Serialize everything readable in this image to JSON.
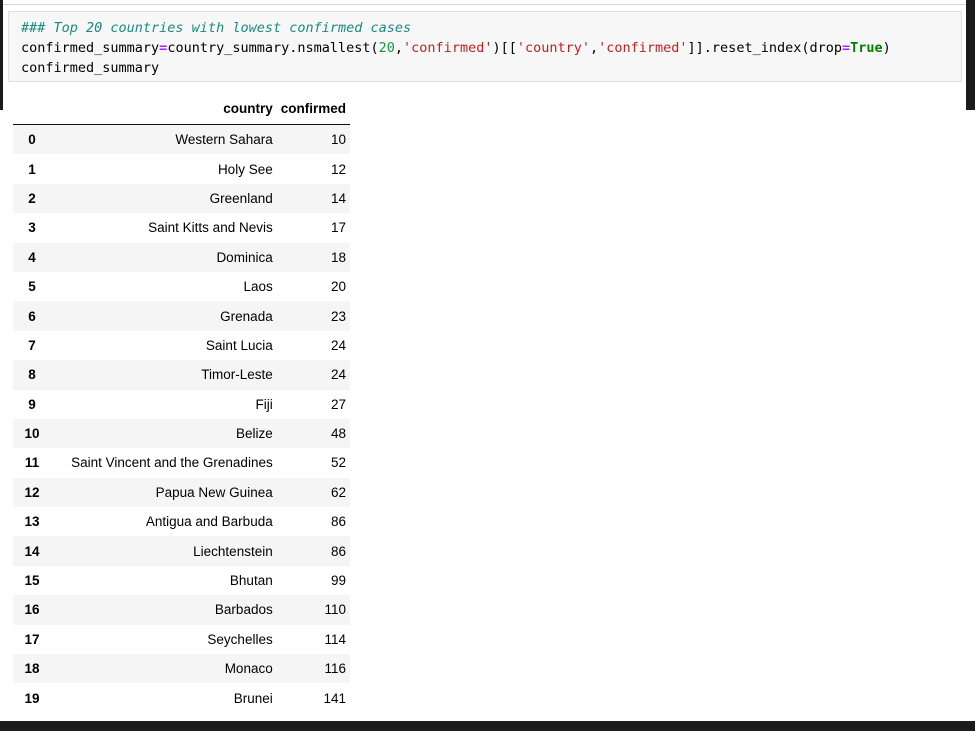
{
  "notebook": {
    "cell": {
      "code_lines": [
        {
          "tokens": [
            {
              "text": "### Top 20 countries with lowest confirmed cases",
              "type": "comment"
            }
          ]
        },
        {
          "tokens": [
            {
              "text": "confirmed_summary",
              "type": "plain"
            },
            {
              "text": "=",
              "type": "op"
            },
            {
              "text": "country_summary.nsmallest(",
              "type": "plain"
            },
            {
              "text": "20",
              "type": "num"
            },
            {
              "text": ",",
              "type": "plain"
            },
            {
              "text": "'confirmed'",
              "type": "str"
            },
            {
              "text": ")[[",
              "type": "plain"
            },
            {
              "text": "'country'",
              "type": "str"
            },
            {
              "text": ",",
              "type": "plain"
            },
            {
              "text": "'confirmed'",
              "type": "str"
            },
            {
              "text": "]].reset_index(drop",
              "type": "plain"
            },
            {
              "text": "=",
              "type": "op"
            },
            {
              "text": "True",
              "type": "kw"
            },
            {
              "text": ")",
              "type": "plain"
            }
          ]
        },
        {
          "tokens": [
            {
              "text": "confirmed_summary",
              "type": "plain"
            }
          ]
        }
      ]
    }
  },
  "table": {
    "index_header": "",
    "columns": [
      "country",
      "confirmed"
    ],
    "rows": [
      {
        "index": "0",
        "country": "Western Sahara",
        "confirmed": "10"
      },
      {
        "index": "1",
        "country": "Holy See",
        "confirmed": "12"
      },
      {
        "index": "2",
        "country": "Greenland",
        "confirmed": "14"
      },
      {
        "index": "3",
        "country": "Saint Kitts and Nevis",
        "confirmed": "17"
      },
      {
        "index": "4",
        "country": "Dominica",
        "confirmed": "18"
      },
      {
        "index": "5",
        "country": "Laos",
        "confirmed": "20"
      },
      {
        "index": "6",
        "country": "Grenada",
        "confirmed": "23"
      },
      {
        "index": "7",
        "country": "Saint Lucia",
        "confirmed": "24"
      },
      {
        "index": "8",
        "country": "Timor-Leste",
        "confirmed": "24"
      },
      {
        "index": "9",
        "country": "Fiji",
        "confirmed": "27"
      },
      {
        "index": "10",
        "country": "Belize",
        "confirmed": "48"
      },
      {
        "index": "11",
        "country": "Saint Vincent and the Grenadines",
        "confirmed": "52"
      },
      {
        "index": "12",
        "country": "Papua New Guinea",
        "confirmed": "62"
      },
      {
        "index": "13",
        "country": "Antigua and Barbuda",
        "confirmed": "86"
      },
      {
        "index": "14",
        "country": "Liechtenstein",
        "confirmed": "86"
      },
      {
        "index": "15",
        "country": "Bhutan",
        "confirmed": "99"
      },
      {
        "index": "16",
        "country": "Barbados",
        "confirmed": "110"
      },
      {
        "index": "17",
        "country": "Seychelles",
        "confirmed": "114"
      },
      {
        "index": "18",
        "country": "Monaco",
        "confirmed": "116"
      },
      {
        "index": "19",
        "country": "Brunei",
        "confirmed": "141"
      }
    ]
  },
  "chart_data": {
    "type": "table",
    "title": "Top 20 countries with lowest confirmed cases",
    "columns": [
      "country",
      "confirmed"
    ],
    "categories": [
      "Western Sahara",
      "Holy See",
      "Greenland",
      "Saint Kitts and Nevis",
      "Dominica",
      "Laos",
      "Grenada",
      "Saint Lucia",
      "Timor-Leste",
      "Fiji",
      "Belize",
      "Saint Vincent and the Grenadines",
      "Papua New Guinea",
      "Antigua and Barbuda",
      "Liechtenstein",
      "Bhutan",
      "Barbados",
      "Seychelles",
      "Monaco",
      "Brunei"
    ],
    "values": [
      10,
      12,
      14,
      17,
      18,
      20,
      23,
      24,
      24,
      27,
      48,
      52,
      62,
      86,
      86,
      99,
      110,
      114,
      116,
      141
    ],
    "xlabel": "country",
    "ylabel": "confirmed"
  },
  "colors": {
    "comment": "#1a8a82",
    "operator": "#aa22ff",
    "number": "#1a9641",
    "string": "#bb2222",
    "keyword": "#008000",
    "cell_background": "#f7f7f7",
    "stripe": "#f5f5f5"
  }
}
